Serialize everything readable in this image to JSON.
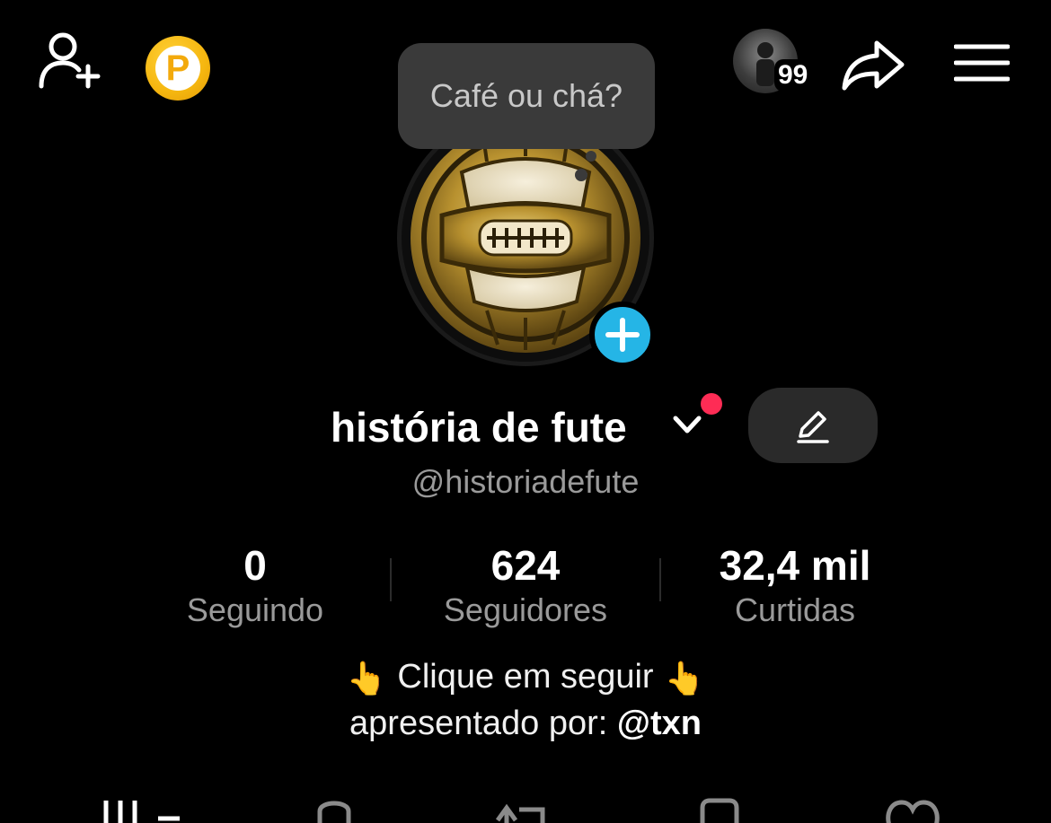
{
  "header": {
    "friend_count": "99"
  },
  "tooltip": {
    "text": "Café ou chá?"
  },
  "profile": {
    "name": "história de fute",
    "handle": "@historiadefute"
  },
  "stats": [
    {
      "value": "0",
      "label": "Seguindo"
    },
    {
      "value": "624",
      "label": "Seguidores"
    },
    {
      "value": "32,4 mil",
      "label": "Curtidas"
    }
  ],
  "bio": {
    "line1": "Clique em seguir",
    "line2_prefix": "apresentado por: ",
    "line2_mention": "@txn",
    "emoji": "👆"
  },
  "icons": {
    "add_friend": "add-user-icon",
    "coin": "coin-icon",
    "share": "share-icon",
    "menu": "menu-icon",
    "edit": "pencil-icon",
    "add_story": "plus-icon"
  },
  "colors": {
    "background": "#000000",
    "accent_blue": "#25b5e6",
    "notification_red": "#fe2c55",
    "coin_gold": "#f5b60f",
    "muted_text": "#9a9a9a",
    "tooltip_bg": "#3a3a3a"
  }
}
